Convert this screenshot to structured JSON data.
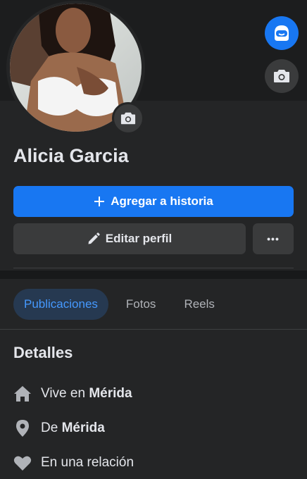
{
  "profile": {
    "name": "Alicia Garcia",
    "avatar_alt": "profile photo"
  },
  "actions": {
    "add_story_label": "Agregar a historia",
    "edit_profile_label": "Editar perfil",
    "more_label": "•••"
  },
  "tabs": [
    {
      "label": "Publicaciones",
      "active": true
    },
    {
      "label": "Fotos",
      "active": false
    },
    {
      "label": "Reels",
      "active": false
    }
  ],
  "details": {
    "title": "Detalles",
    "items": [
      {
        "icon": "home-icon",
        "prefix": "Vive en ",
        "value": "Mérida"
      },
      {
        "icon": "location-pin-icon",
        "prefix": "De ",
        "value": "Mérida"
      },
      {
        "icon": "heart-icon",
        "prefix": "En una relación",
        "value": ""
      }
    ]
  },
  "colors": {
    "background": "#242526",
    "accent": "#1877f2",
    "secondary_button": "#3a3b3c",
    "active_tab_bg": "#263951",
    "active_tab_text": "#4599ff"
  }
}
